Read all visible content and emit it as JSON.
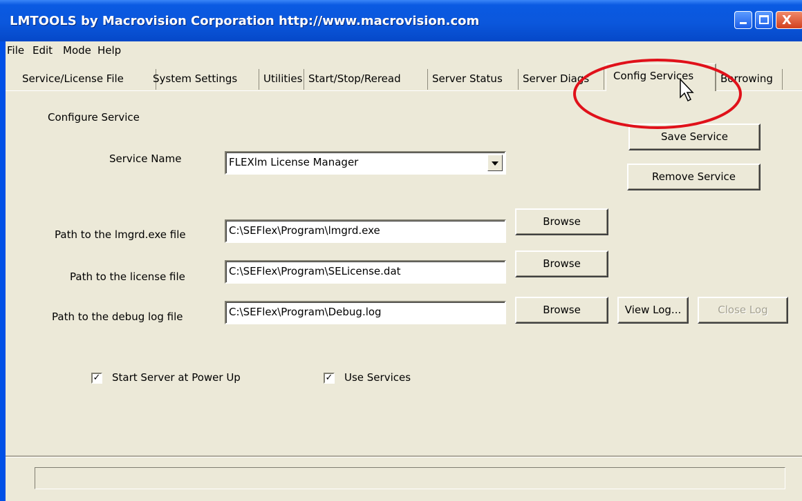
{
  "window": {
    "title": "LMTOOLS by Macrovision Corporation http://www.macrovision.com",
    "buttons": {
      "minimize": "minimize",
      "maximize": "maximize",
      "close": "X"
    }
  },
  "menu": [
    "File",
    "Edit",
    "Mode",
    "Help"
  ],
  "tabs": [
    {
      "label": "Service/License File"
    },
    {
      "label": "System Settings"
    },
    {
      "label": "Utilities"
    },
    {
      "label": "Start/Stop/Reread"
    },
    {
      "label": "Server Status"
    },
    {
      "label": "Server Diags"
    },
    {
      "label": "Config Services",
      "active": true
    },
    {
      "label": "Borrowing"
    }
  ],
  "panel": {
    "section_title": "Configure Service",
    "service_name_label": "Service Name",
    "service_name_value": "FLEXlm License Manager",
    "save_service": "Save Service",
    "remove_service": "Remove Service",
    "lmgrd_label": "Path to the lmgrd.exe file",
    "lmgrd_value": "C:\\SEFlex\\Program\\lmgrd.exe",
    "license_label": "Path to the license file",
    "license_value": "C:\\SEFlex\\Program\\SELicense.dat",
    "debug_label": "Path to the debug log file",
    "debug_value": "C:\\SEFlex\\Program\\Debug.log",
    "browse": "Browse",
    "view_log": "View Log...",
    "close_log": "Close Log",
    "start_at_power_up": {
      "label": "Start Server at Power Up",
      "checked": true
    },
    "use_services": {
      "label": "Use Services",
      "checked": true
    }
  },
  "status_text": "",
  "colors": {
    "titlebar": "#0b57dc",
    "face": "#ece9d8",
    "highlight": "#e0111a"
  }
}
